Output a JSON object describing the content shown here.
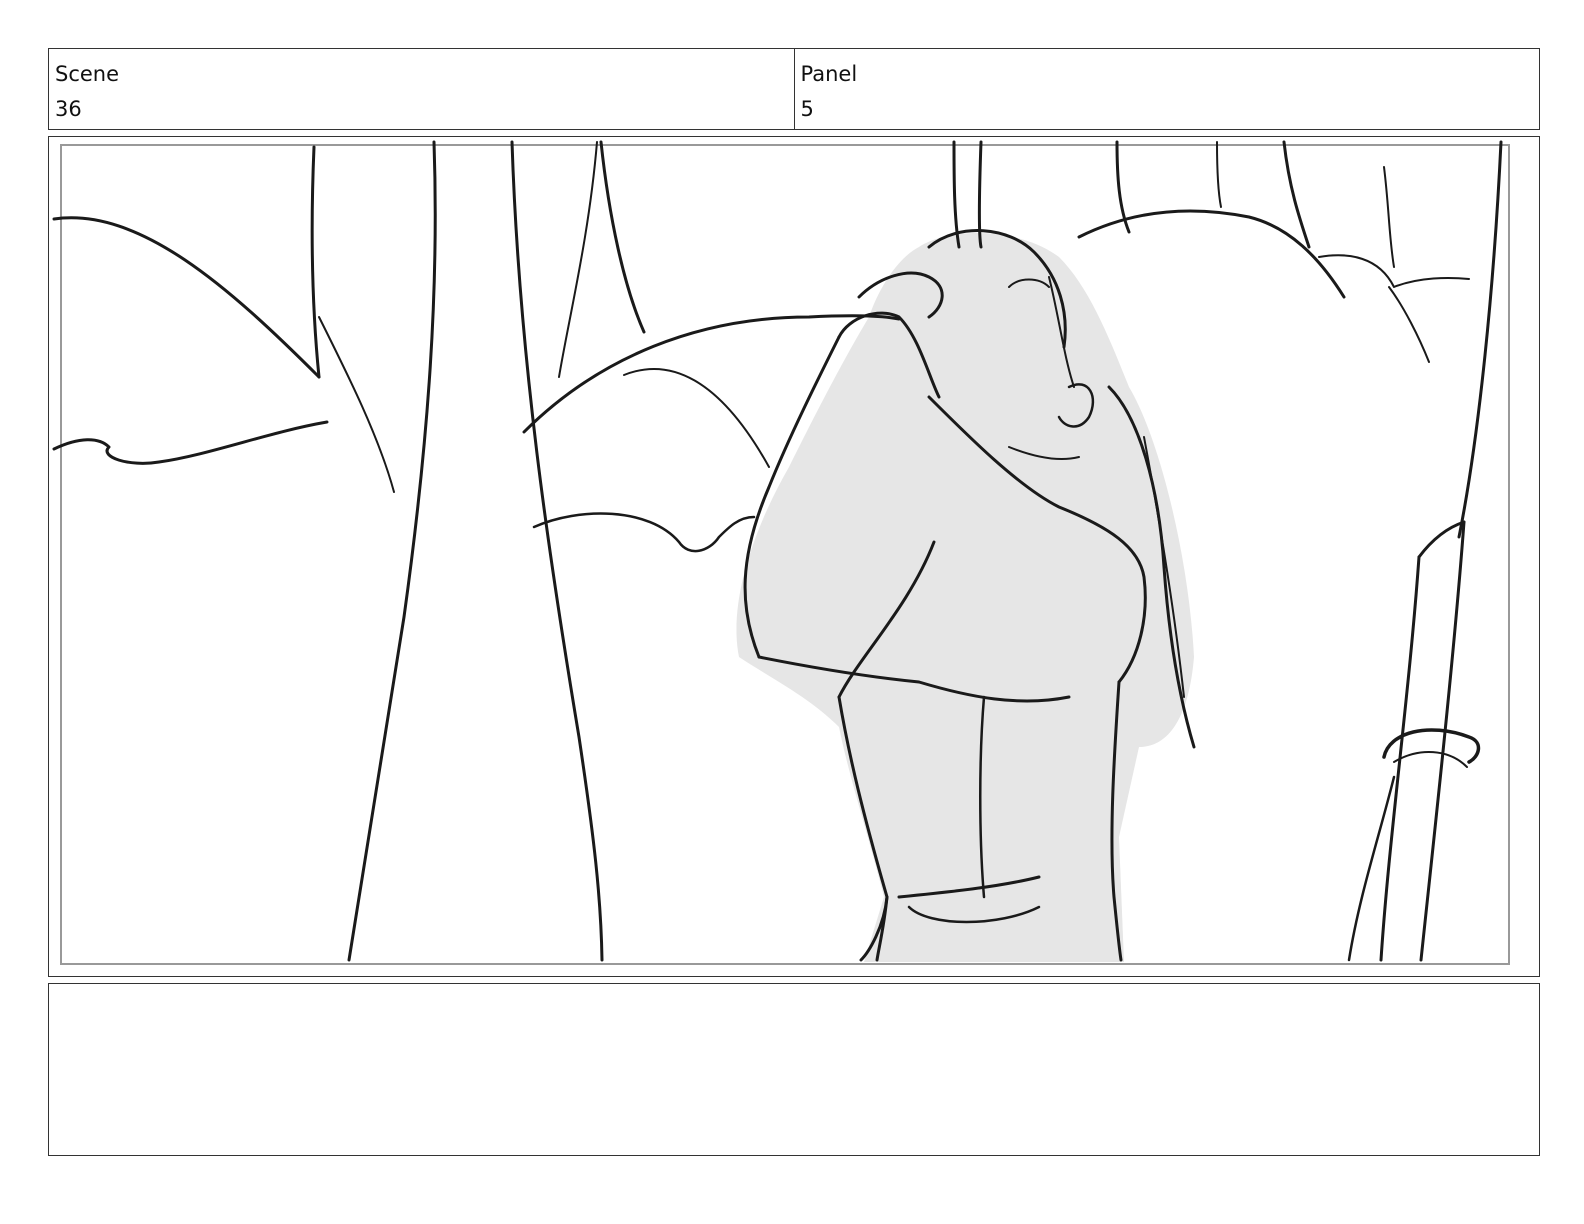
{
  "header": {
    "scene": {
      "label": "Scene",
      "value": "36"
    },
    "panel": {
      "label": "Panel",
      "value": "5"
    }
  },
  "drawing": {
    "subject": "sketch-illustration",
    "colors": {
      "line": "#1a1a1a",
      "fill": "#e6e6e6",
      "safe_frame": "#999999"
    }
  },
  "notes": {
    "text": ""
  }
}
